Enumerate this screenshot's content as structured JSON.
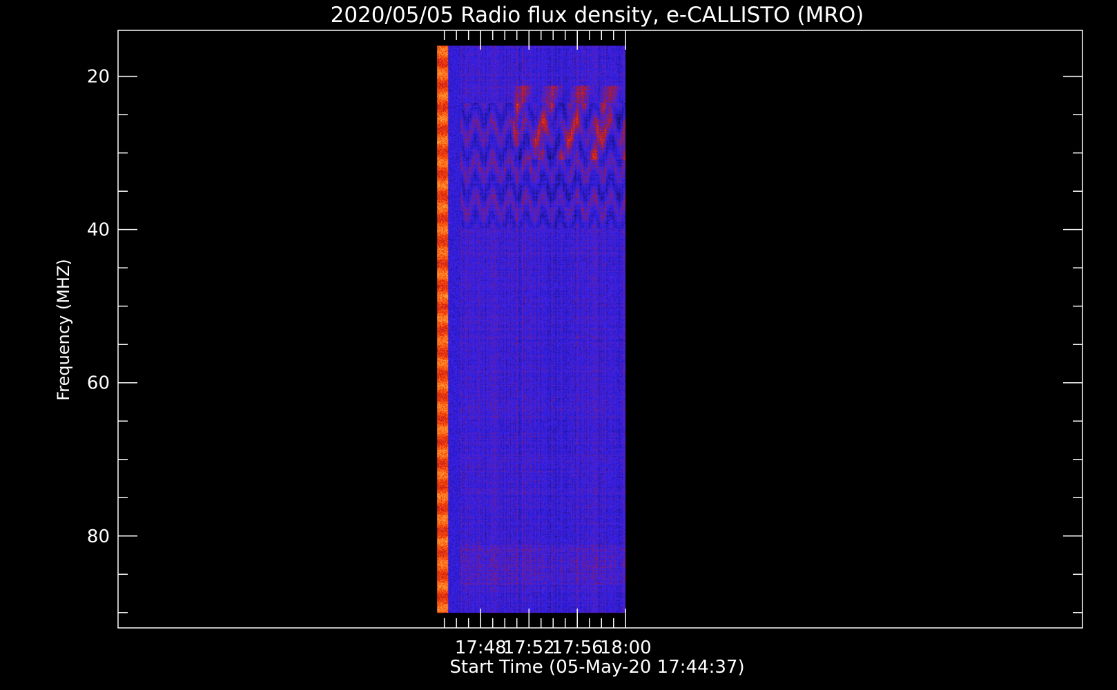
{
  "chart_data": {
    "type": "heatmap",
    "title": "2020/05/05  Radio flux density, e-CALLISTO (MRO)",
    "xlabel": "Start Time (05-May-20 17:44:37)",
    "ylabel": "Frequency (MHZ)",
    "x_range_minutes": [
      17.3,
      18.63
    ],
    "data_extent_minutes": [
      17.74,
      18.0
    ],
    "x_ticks": [
      {
        "value": 17.8,
        "label": "17:48"
      },
      {
        "value": 17.8667,
        "label": "17:52"
      },
      {
        "value": 17.9333,
        "label": "17:56"
      },
      {
        "value": 18.0,
        "label": "18:00"
      }
    ],
    "y_range": [
      14,
      92
    ],
    "y_inverted": true,
    "y_major_ticks": [
      20,
      40,
      60,
      80
    ],
    "y_minor_ticks": [
      25,
      30,
      35,
      45,
      50,
      55,
      65,
      70,
      75,
      85,
      90
    ],
    "data_freq_extent": [
      16,
      90
    ],
    "colormap": [
      "#000000",
      "#1a0f60",
      "#2a1acf",
      "#3d24f0",
      "#8a1a5a",
      "#d8200a",
      "#ff5a10",
      "#ffb040"
    ],
    "background_color": "#000000",
    "frame_color": "#ffffff"
  }
}
